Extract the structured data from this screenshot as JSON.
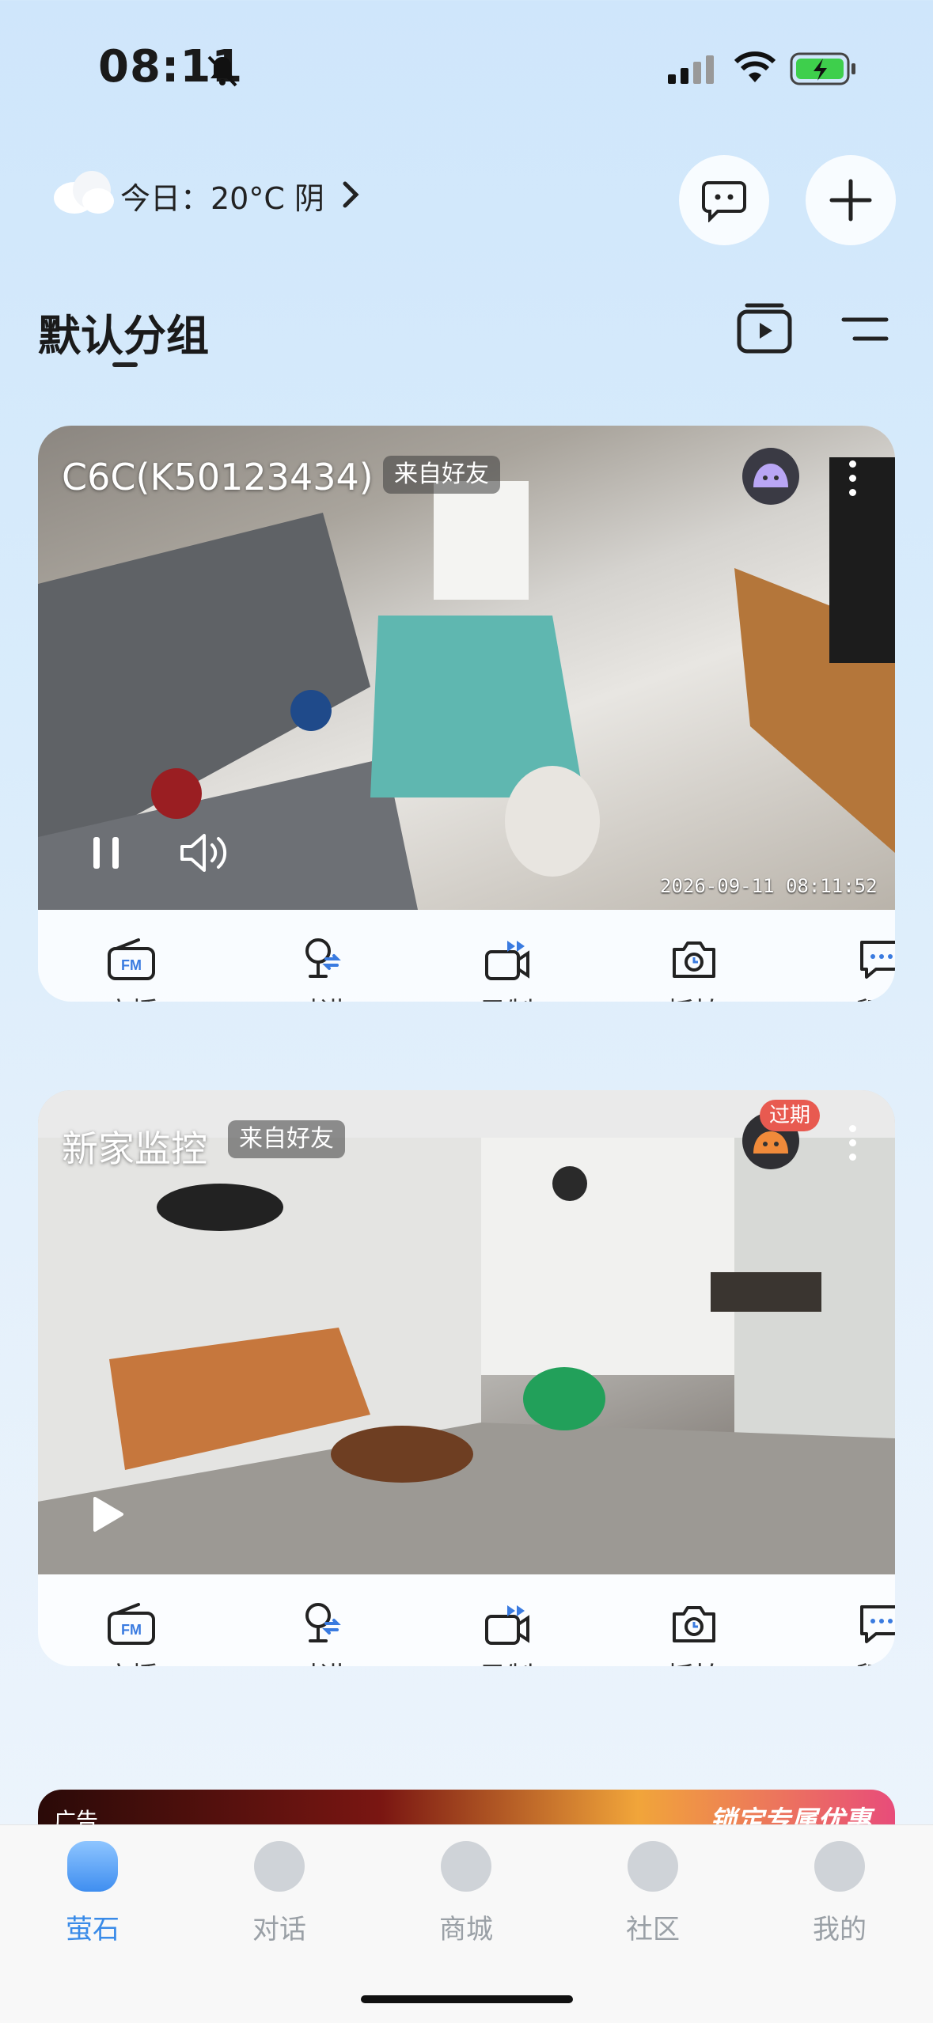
{
  "status_bar": {
    "time": "08:11"
  },
  "weather": {
    "text": "今日：20°C 阴"
  },
  "group": {
    "title": "默认分组"
  },
  "cameras": [
    {
      "name": "C6C(K50123434)",
      "tag": "来自好友",
      "timestamp": "2026-09-11 08:11:52"
    },
    {
      "name": "新家监控",
      "tag": "来自好友",
      "badge": "过期"
    }
  ],
  "actions": [
    "广播",
    "对讲",
    "录制",
    "抓拍",
    "留言"
  ],
  "ad": {
    "label": "广告",
    "text": "锁定专属优惠"
  },
  "tabs": [
    {
      "label": "萤石",
      "active": true
    },
    {
      "label": "对话"
    },
    {
      "label": "商城"
    },
    {
      "label": "社区"
    },
    {
      "label": "我的"
    }
  ],
  "colors": {
    "accent": "#3a8be8",
    "expired_badge": "#e85a50"
  }
}
